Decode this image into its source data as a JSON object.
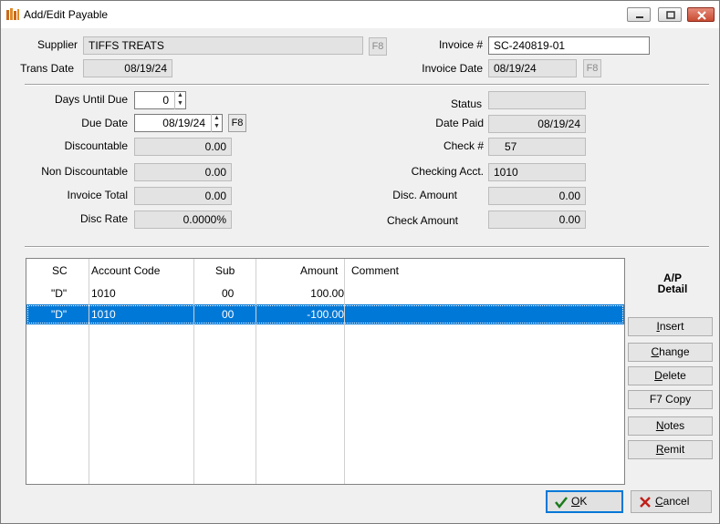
{
  "window": {
    "title": "Add/Edit Payable",
    "minimize": "minimize",
    "restore": "restore",
    "close": "close"
  },
  "header": {
    "supplier_label": "Supplier",
    "supplier_value": "TIFFS TREATS",
    "trans_date_label": "Trans Date",
    "trans_date_value": "08/19/24",
    "invoice_no_label": "Invoice #",
    "invoice_no_value": "SC-240819-01",
    "invoice_date_label": "Invoice Date",
    "invoice_date_value": "08/19/24",
    "f8": "F8"
  },
  "left": {
    "days_until_due_label": "Days Until Due",
    "days_until_due_value": "0",
    "due_date_label": "Due Date",
    "due_date_value": "08/19/24",
    "discountable_label": "Discountable",
    "discountable_value": "0.00",
    "non_discountable_label": "Non Discountable",
    "non_discountable_value": "0.00",
    "invoice_total_label": "Invoice Total",
    "invoice_total_value": "0.00",
    "disc_rate_label": "Disc Rate",
    "disc_rate_value": "0.0000%"
  },
  "right": {
    "status_label": "Status",
    "status_value": "",
    "date_paid_label": "Date Paid",
    "date_paid_value": "08/19/24",
    "check_no_label": "Check #",
    "check_no_value": "57",
    "checking_acct_label": "Checking Acct.",
    "checking_acct_value": "1010",
    "disc_amount_label": "Disc. Amount",
    "disc_amount_value": "0.00",
    "check_amount_label": "Check Amount",
    "check_amount_value": "0.00"
  },
  "grid": {
    "columns": [
      "SC",
      "Account Code",
      "Sub",
      "Amount",
      "Comment"
    ],
    "rows": [
      {
        "sc": "\"D\"",
        "account": "1010",
        "sub": "00",
        "amount": "100.00",
        "comment": ""
      },
      {
        "sc": "\"D\"",
        "account": "1010",
        "sub": "00",
        "amount": "-100.00",
        "comment": "",
        "selected": true
      }
    ]
  },
  "side": {
    "title_line1": "A/P",
    "title_line2": "Detail",
    "insert_pre": "",
    "insert_key": "I",
    "insert_post": "nsert",
    "change_pre": "",
    "change_key": "C",
    "change_post": "hange",
    "delete_pre": "",
    "delete_key": "D",
    "delete_post": "elete",
    "copy": "F7 Copy",
    "notes_pre": "",
    "notes_key": "N",
    "notes_post": "otes",
    "remit_pre": "",
    "remit_key": "R",
    "remit_post": "emit"
  },
  "footer": {
    "ok_key": "O",
    "ok_post": "K",
    "cancel_key": "C",
    "cancel_post": "ancel"
  },
  "colors": {
    "selection": "#0078d7",
    "ok_check": "#1a7a1a",
    "cancel_x": "#c0201a"
  }
}
